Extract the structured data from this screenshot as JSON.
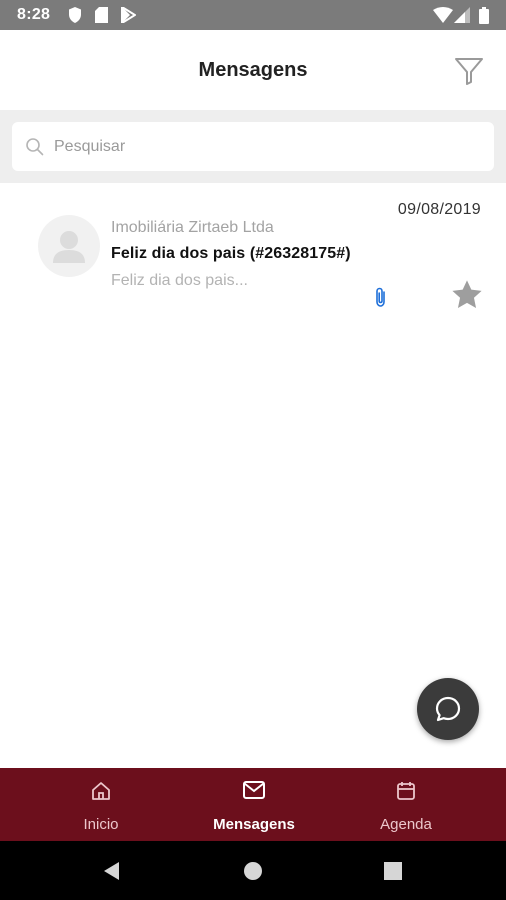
{
  "status_bar": {
    "time": "8:28"
  },
  "app_bar": {
    "title": "Mensagens"
  },
  "search": {
    "placeholder": "Pesquisar"
  },
  "messages": [
    {
      "sender": "Imobiliária Zirtaeb Ltda",
      "subject": "Feliz dia dos pais (#26328175#)",
      "preview": "Feliz dia dos pais...",
      "date": "09/08/2019",
      "has_attachment": true,
      "starred": false
    }
  ],
  "bottom_nav": {
    "items": [
      {
        "label": "Inicio",
        "icon": "home-icon",
        "active": false
      },
      {
        "label": "Mensagens",
        "icon": "mail-icon",
        "active": true
      },
      {
        "label": "Agenda",
        "icon": "calendar-icon",
        "active": false
      }
    ]
  },
  "colors": {
    "brand": "#6c0f1c",
    "status_bar": "#7b7b7b",
    "fab": "#3b3b3b",
    "attachment": "#1e6fd9"
  }
}
